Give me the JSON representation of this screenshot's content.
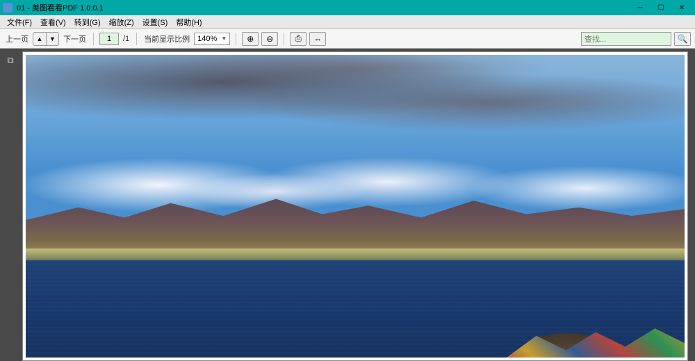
{
  "titlebar": {
    "title": "01  - 美图看看PDF 1.0.0.1"
  },
  "menubar": {
    "file": "文件(F)",
    "view": "查看(V)",
    "goto": "转到(G)",
    "zoom": "缩放(Z)",
    "settings": "设置(S)",
    "help": "帮助(H)"
  },
  "toolbar": {
    "prev_page": "上一页",
    "next_page": "下一页",
    "page_current": "1",
    "page_total": "/1",
    "zoom_label": "当前显示比例",
    "zoom_value": "140%",
    "search_placeholder": "查找..."
  }
}
